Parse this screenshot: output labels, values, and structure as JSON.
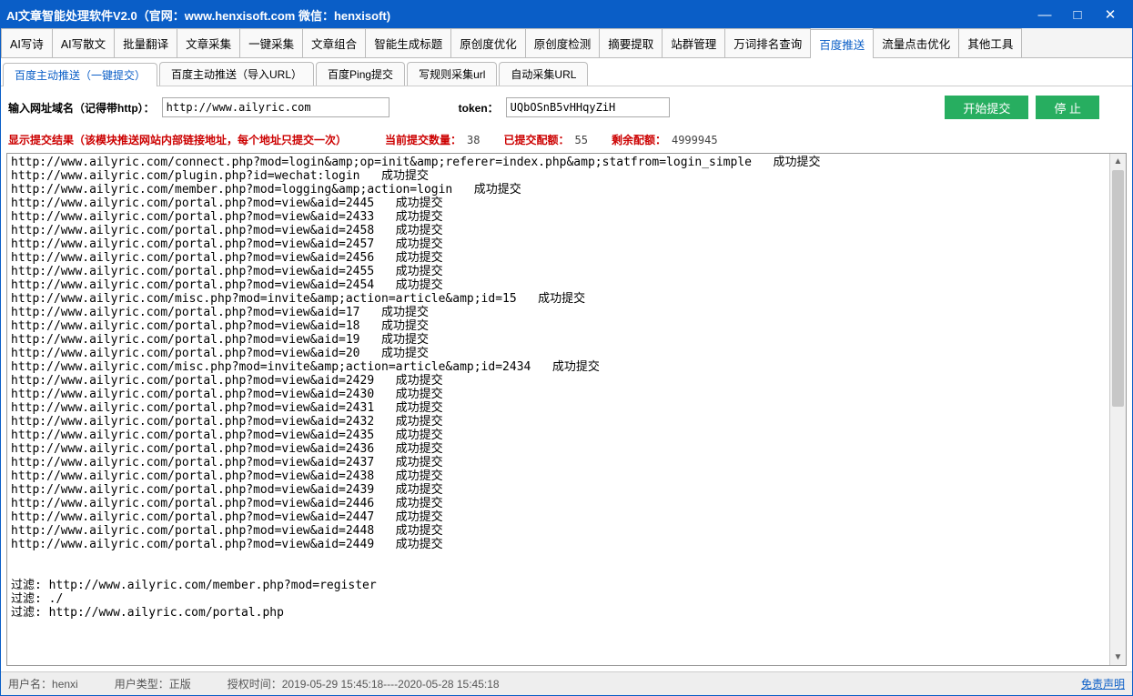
{
  "titlebar": {
    "title": "AI文章智能处理软件V2.0（官网：www.henxisoft.com  微信：henxisoft)"
  },
  "mainTabs": [
    "AI写诗",
    "AI写散文",
    "批量翻译",
    "文章采集",
    "一键采集",
    "文章组合",
    "智能生成标题",
    "原创度优化",
    "原创度检测",
    "摘要提取",
    "站群管理",
    "万词排名查询",
    "百度推送",
    "流量点击优化",
    "其他工具"
  ],
  "mainTabActive": 12,
  "subTabs": [
    "百度主动推送（一键提交）",
    "百度主动推送（导入URL）",
    "百度Ping提交",
    "写规则采集url",
    "自动采集URL"
  ],
  "subTabActive": 0,
  "form": {
    "urlLabel": "输入网址域名（记得带http）：",
    "urlValue": "http://www.ailyric.com",
    "tokenLabel": "token：",
    "tokenValue": "UQbOSnB5vHHqyZiH",
    "startBtn": "开始提交",
    "stopBtn": "停 止"
  },
  "stats": {
    "resultLabel": "显示提交结果（该模块推送网站内部链接地址，每个地址只提交一次）",
    "currentLabel": "当前提交数量：",
    "currentVal": "38",
    "submittedLabel": "已提交配额：",
    "submittedVal": "55",
    "remainLabel": "剩余配额：",
    "remainVal": "4999945"
  },
  "log": "http://www.ailyric.com/connect.php?mod=login&amp;op=init&amp;referer=index.php&amp;statfrom=login_simple   成功提交\nhttp://www.ailyric.com/plugin.php?id=wechat:login   成功提交\nhttp://www.ailyric.com/member.php?mod=logging&amp;action=login   成功提交\nhttp://www.ailyric.com/portal.php?mod=view&aid=2445   成功提交\nhttp://www.ailyric.com/portal.php?mod=view&aid=2433   成功提交\nhttp://www.ailyric.com/portal.php?mod=view&aid=2458   成功提交\nhttp://www.ailyric.com/portal.php?mod=view&aid=2457   成功提交\nhttp://www.ailyric.com/portal.php?mod=view&aid=2456   成功提交\nhttp://www.ailyric.com/portal.php?mod=view&aid=2455   成功提交\nhttp://www.ailyric.com/portal.php?mod=view&aid=2454   成功提交\nhttp://www.ailyric.com/misc.php?mod=invite&amp;action=article&amp;id=15   成功提交\nhttp://www.ailyric.com/portal.php?mod=view&aid=17   成功提交\nhttp://www.ailyric.com/portal.php?mod=view&aid=18   成功提交\nhttp://www.ailyric.com/portal.php?mod=view&aid=19   成功提交\nhttp://www.ailyric.com/portal.php?mod=view&aid=20   成功提交\nhttp://www.ailyric.com/misc.php?mod=invite&amp;action=article&amp;id=2434   成功提交\nhttp://www.ailyric.com/portal.php?mod=view&aid=2429   成功提交\nhttp://www.ailyric.com/portal.php?mod=view&aid=2430   成功提交\nhttp://www.ailyric.com/portal.php?mod=view&aid=2431   成功提交\nhttp://www.ailyric.com/portal.php?mod=view&aid=2432   成功提交\nhttp://www.ailyric.com/portal.php?mod=view&aid=2435   成功提交\nhttp://www.ailyric.com/portal.php?mod=view&aid=2436   成功提交\nhttp://www.ailyric.com/portal.php?mod=view&aid=2437   成功提交\nhttp://www.ailyric.com/portal.php?mod=view&aid=2438   成功提交\nhttp://www.ailyric.com/portal.php?mod=view&aid=2439   成功提交\nhttp://www.ailyric.com/portal.php?mod=view&aid=2446   成功提交\nhttp://www.ailyric.com/portal.php?mod=view&aid=2447   成功提交\nhttp://www.ailyric.com/portal.php?mod=view&aid=2448   成功提交\nhttp://www.ailyric.com/portal.php?mod=view&aid=2449   成功提交\n\n\n过滤: http://www.ailyric.com/member.php?mod=register\n过滤: ./\n过滤: http://www.ailyric.com/portal.php",
  "status": {
    "userLabel": "用户名：",
    "userVal": "henxi",
    "typeLabel": "用户类型：",
    "typeVal": "正版",
    "authLabel": "授权时间：",
    "authVal": "2019-05-29 15:45:18----2020-05-28 15:45:18",
    "disclaimer": "免责声明"
  }
}
